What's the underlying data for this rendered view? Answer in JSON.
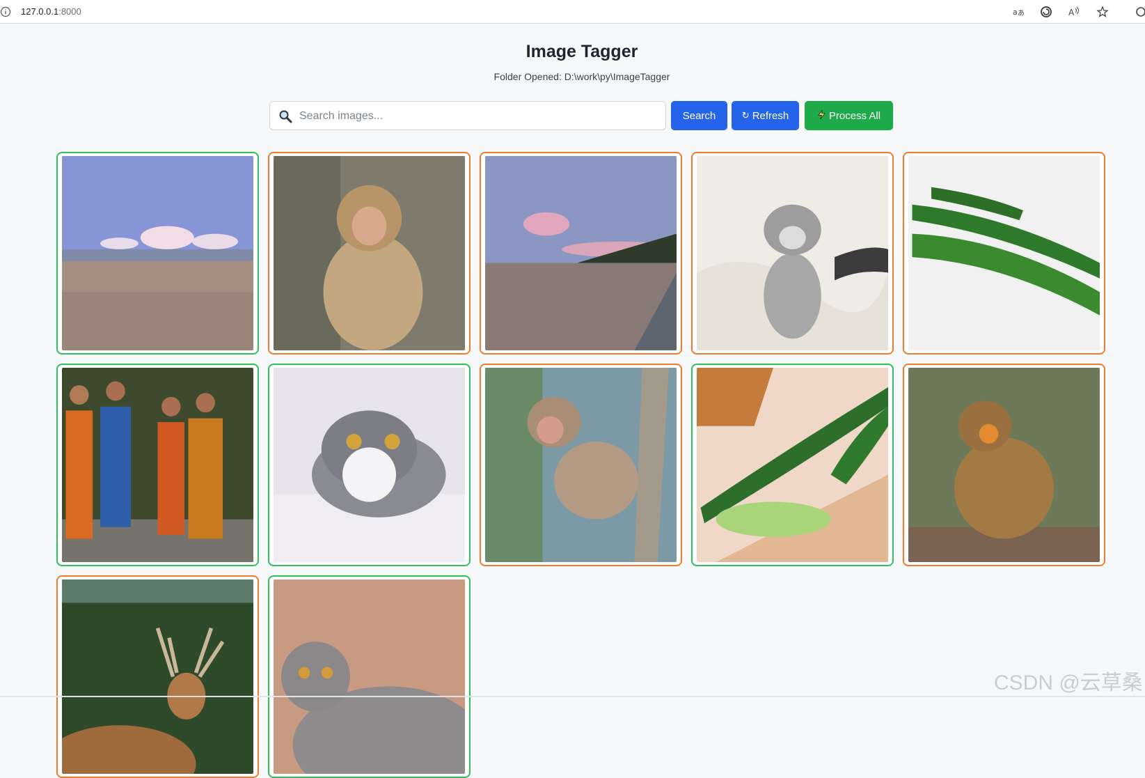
{
  "browser": {
    "url_host": "127.0.0.1",
    "url_port": ":8000",
    "icons": [
      "info-icon",
      "translate-icon",
      "refresh-sync-icon",
      "read-aloud-icon",
      "favorite-star-icon",
      "extensions-icon"
    ]
  },
  "header": {
    "title": "Image Tagger",
    "folder": "Folder Opened: D:\\work\\py\\ImageTagger"
  },
  "search": {
    "placeholder": "Search images...",
    "value": "",
    "search_label": "Search",
    "refresh_label": "Refresh",
    "process_all_label": "Process All"
  },
  "colors": {
    "processed_border": "#2fbf5b",
    "pending_border": "#f07a2e",
    "primary_button": "#2563eb",
    "process_button": "#1faa4a"
  },
  "images": [
    {
      "subject": "beach with clouds",
      "status": "processed"
    },
    {
      "subject": "monkey sitting",
      "status": "pending"
    },
    {
      "subject": "beach at dusk",
      "status": "pending"
    },
    {
      "subject": "silver tabby kitten",
      "status": "pending"
    },
    {
      "subject": "cucumbers",
      "status": "pending"
    },
    {
      "subject": "monks walking",
      "status": "processed"
    },
    {
      "subject": "grey and white cat",
      "status": "processed"
    },
    {
      "subject": "monkey on tree",
      "status": "pending"
    },
    {
      "subject": "sliced cucumber on board",
      "status": "processed"
    },
    {
      "subject": "monkey eating",
      "status": "pending"
    },
    {
      "subject": "deer with antlers",
      "status": "pending"
    },
    {
      "subject": "grey british shorthair cat",
      "status": "processed"
    }
  ],
  "watermark": "CSDN @云草桑"
}
